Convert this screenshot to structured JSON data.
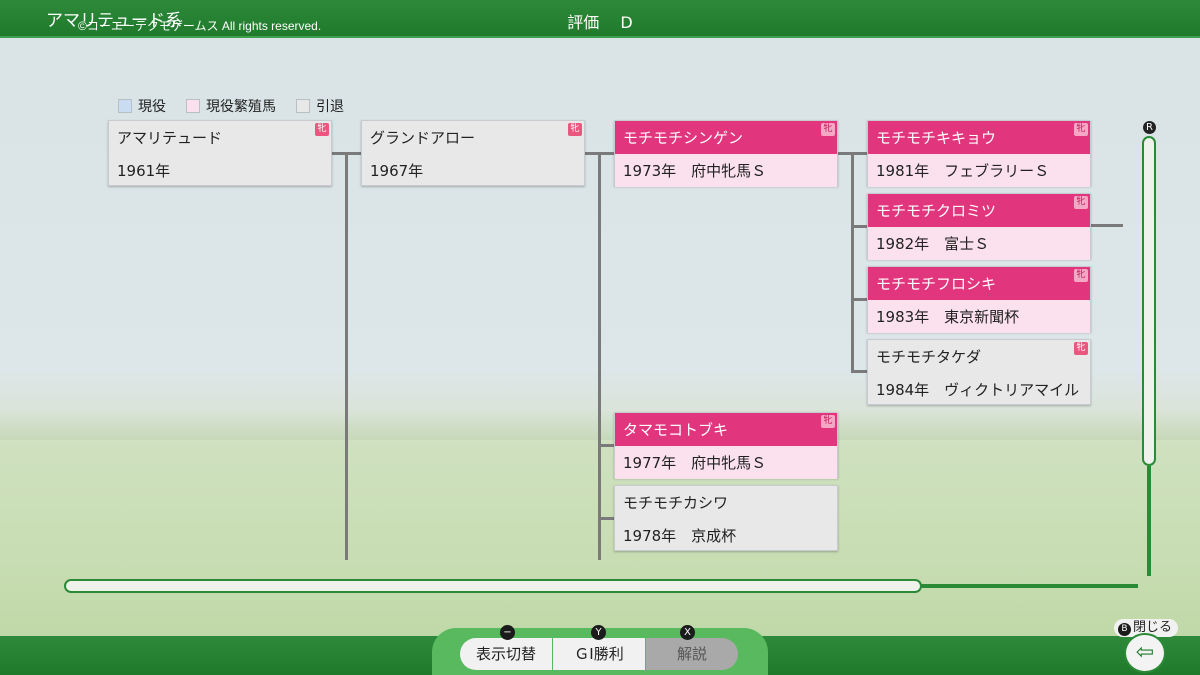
{
  "header": {
    "line_title": "アマリテュード系",
    "copyright": "©コーエーテクモゲームス All rights reserved.",
    "rating_label": "評価",
    "rating_value": "D"
  },
  "legend": [
    {
      "label": "現役",
      "color": "#c9dcf2"
    },
    {
      "label": "現役繁殖馬",
      "color": "#fbe1ee"
    },
    {
      "label": "引退",
      "color": "#e8e8e8"
    }
  ],
  "badge_text": "牝",
  "horses": [
    {
      "name": "アマリテュード",
      "info": "1961年",
      "status": "retired"
    },
    {
      "name": "グランドアロー",
      "info": "1967年",
      "status": "retired"
    },
    {
      "name": "モチモチシンゲン",
      "info": "1973年　府中牝馬Ｓ",
      "status": "breeding"
    },
    {
      "name": "モチモチキキョウ",
      "info": "1981年　フェブラリーＳ",
      "status": "breeding"
    },
    {
      "name": "モチモチクロミツ",
      "info": "1982年　富士Ｓ",
      "status": "breeding"
    },
    {
      "name": "モチモチフロシキ",
      "info": "1983年　東京新聞杯",
      "status": "breeding"
    },
    {
      "name": "モチモチタケダ",
      "info": "1984年　ヴィクトリアマイル",
      "status": "retired"
    },
    {
      "name": "タマモコトブキ",
      "info": "1977年　府中牝馬Ｓ",
      "status": "breeding"
    },
    {
      "name": "モチモチカシワ",
      "info": "1978年　京成杯",
      "status": "retired"
    }
  ],
  "scroll": {
    "v_label": "R"
  },
  "footer": {
    "buttons": [
      {
        "icon": "−",
        "label": "表示切替"
      },
      {
        "icon": "Y",
        "label": "ＧⅠ勝利"
      },
      {
        "icon": "X",
        "label": "解説"
      }
    ],
    "close_icon": "B",
    "close_label": "閉じる",
    "close_glyph": "⇦"
  }
}
